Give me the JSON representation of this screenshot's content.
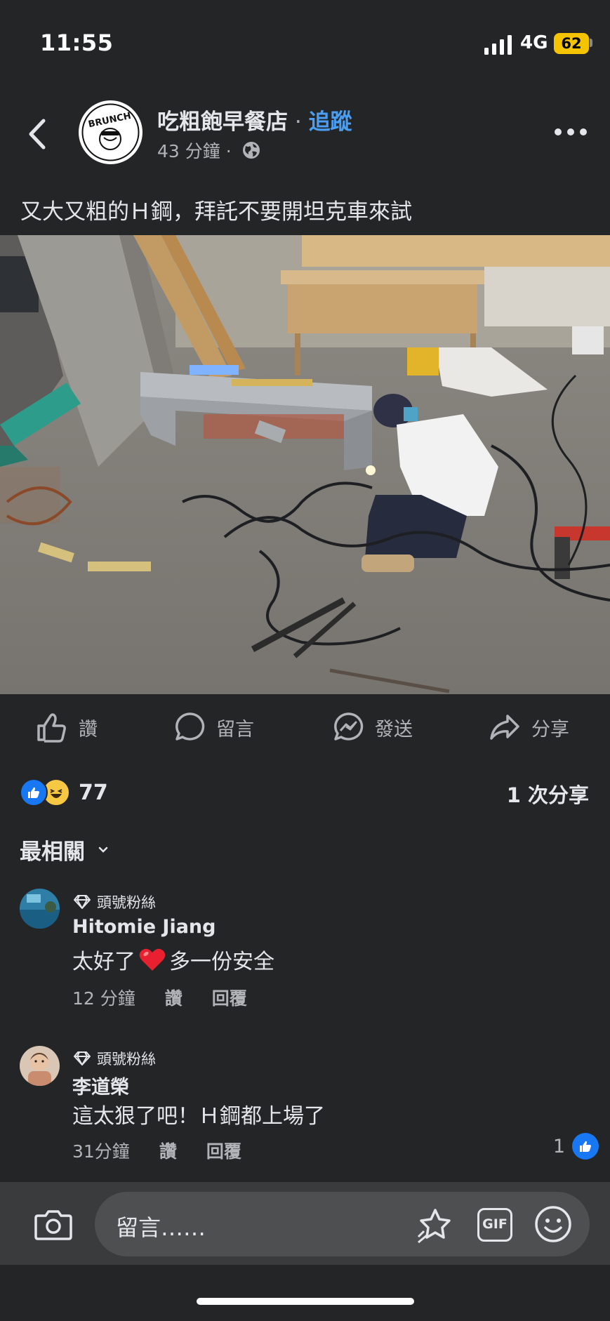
{
  "status_bar": {
    "time": "11:55",
    "network": "4G",
    "battery": "62"
  },
  "post": {
    "page_name": "吃粗飽早餐店",
    "separator": " · ",
    "follow_label": "追蹤",
    "time": "43 分鐘",
    "meta_sep": " ·",
    "text": "又大又粗的Ｈ鋼，拜託不要開坦克車來試",
    "avatar_text": "BRUNCH"
  },
  "actions": {
    "like": "讚",
    "comment": "留言",
    "send": "發送",
    "share": "分享"
  },
  "reactions": {
    "count": "77",
    "shares": "1 次分享"
  },
  "sort": {
    "label": "最相關"
  },
  "comments": [
    {
      "badge": "頭號粉絲",
      "name": "Hitomie Jiang",
      "text_before": "太好了",
      "text_after": "多一份安全",
      "time": "12 分鐘",
      "like": "讚",
      "reply": "回覆"
    },
    {
      "badge": "頭號粉絲",
      "name": "李道榮",
      "text": "這太狠了吧！Ｈ鋼都上場了",
      "time": "31分鐘",
      "like": "讚",
      "reply": "回覆",
      "like_count": "1"
    }
  ],
  "composer": {
    "placeholder": "留言……",
    "gif": "GIF"
  },
  "colors": {
    "background": "#242526",
    "accent": "#4a9ff5",
    "like_blue": "#1877f2",
    "battery": "#f5c400"
  }
}
